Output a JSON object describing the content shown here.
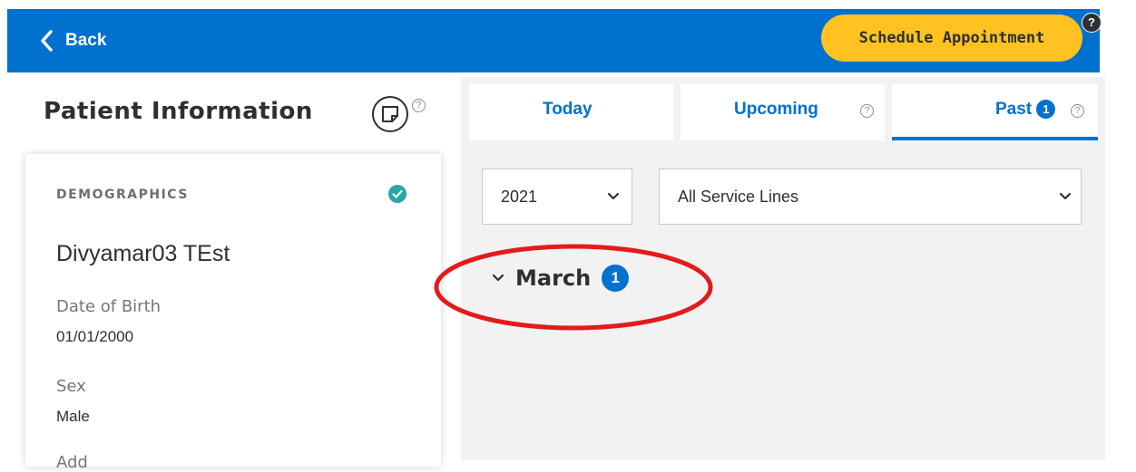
{
  "header": {
    "back_label": "Back",
    "schedule_label": "Schedule Appointment",
    "help_glyph": "?",
    "colors": {
      "bar": "#0071ce",
      "button": "#ffc220"
    }
  },
  "patient_panel": {
    "title": "Patient Information",
    "help_glyph": "?",
    "demographics_label": "DEMOGRAPHICS",
    "name": "Divyamar03 TEst",
    "fields": [
      {
        "label": "Date of Birth",
        "value": "01/01/2000"
      },
      {
        "label": "Sex",
        "value": "Male"
      }
    ],
    "partial_label": "Add"
  },
  "tabs": [
    {
      "label": "Today",
      "help": false
    },
    {
      "label": "Upcoming",
      "help": true,
      "help_glyph": "?"
    },
    {
      "label": "Past",
      "badge": "1",
      "help": true,
      "help_glyph": "?",
      "active": true
    }
  ],
  "filters": {
    "year": "2021",
    "service_lines": "All Service Lines"
  },
  "month_group": {
    "label": "March",
    "count": "1"
  },
  "annotation": {
    "color": "#e31b1b"
  },
  "icons": [
    "chevron-left-icon",
    "help-icon",
    "sticky-note-icon",
    "check-circle-icon",
    "chevron-down-icon"
  ]
}
